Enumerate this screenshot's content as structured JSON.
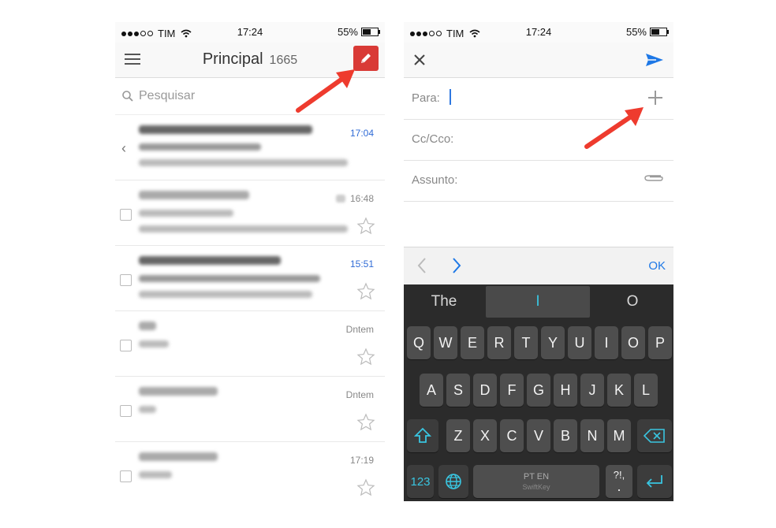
{
  "status": {
    "carrier": "TIM",
    "time": "17:24",
    "battery": "55%",
    "battery_level": 0.55
  },
  "inbox": {
    "title": "Principal",
    "count": "1665",
    "search_placeholder": "Pesquisar",
    "rows": [
      {
        "time": "17:04",
        "unread": true
      },
      {
        "time": "16:48",
        "unread": false
      },
      {
        "time": "15:51",
        "unread": true
      },
      {
        "time": "Dntem",
        "unread": false
      },
      {
        "time": "Dntem",
        "unread": false
      },
      {
        "time": "17:19",
        "unread": false
      }
    ]
  },
  "compose": {
    "to_label": "Para:",
    "cc_label": "Cc/Cco:",
    "subject_label": "Assunto:",
    "ok_label": "OK"
  },
  "keyboard": {
    "suggestions": [
      "The",
      "I",
      "O"
    ],
    "row1": [
      "Q",
      "W",
      "E",
      "R",
      "T",
      "Y",
      "U",
      "I",
      "O",
      "P"
    ],
    "row2": [
      "A",
      "S",
      "D",
      "F",
      "G",
      "H",
      "J",
      "K",
      "L"
    ],
    "row3": [
      "Z",
      "X",
      "C",
      "V",
      "B",
      "N",
      "M"
    ],
    "numbers_key": "123",
    "space_label": "PT EN",
    "space_brand": "SwiftKey",
    "punct_top": "?!,",
    "punct_bottom": "."
  },
  "colors": {
    "accent": "#d93a36",
    "link": "#1e78e6",
    "highlight": "#39c5e0",
    "arrow": "#ee3b2e"
  }
}
